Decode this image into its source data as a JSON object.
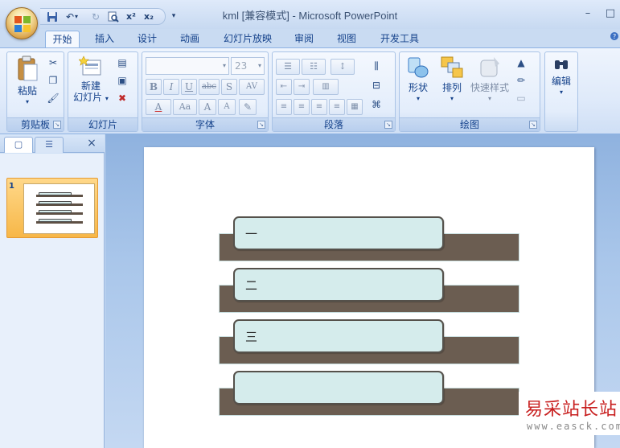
{
  "window": {
    "title": "kml [兼容模式] - Microsoft PowerPoint",
    "minimize_icon": "–",
    "maximize_icon": "□"
  },
  "qat": {
    "save_icon": "floppy",
    "undo_icon": "↶",
    "undo_arrow": "▾",
    "redo_icon": "↻",
    "preview_icon": "magnifier",
    "superscript": "x²",
    "subscript": "x₂",
    "customize": "▾"
  },
  "tabs": [
    {
      "label": "开始",
      "active": true
    },
    {
      "label": "插入"
    },
    {
      "label": "设计"
    },
    {
      "label": "动画"
    },
    {
      "label": "幻灯片放映"
    },
    {
      "label": "审阅"
    },
    {
      "label": "视图"
    },
    {
      "label": "开发工具"
    }
  ],
  "ribbon": {
    "clipboard": {
      "paste": "粘贴",
      "group": "剪贴板"
    },
    "slides": {
      "new_slide_line1": "新建",
      "new_slide_line2": "幻灯片",
      "group": "幻灯片"
    },
    "font": {
      "font_name": "",
      "font_size": "23",
      "group": "字体",
      "bold": "B",
      "italic": "I",
      "underline": "U",
      "strike": "abc",
      "shadow": "S",
      "spacing": "AV",
      "color": "A",
      "case": "Aa",
      "grow": "A",
      "shrink": "A"
    },
    "paragraph": {
      "group": "段落"
    },
    "drawing": {
      "shapes": "形状",
      "arrange": "排列",
      "quick_styles": "快速样式",
      "group": "绘图"
    },
    "editing": {
      "label": "编辑"
    }
  },
  "leftpane": {
    "close": "×",
    "slide_number": "1"
  },
  "slide": {
    "boxes": [
      {
        "text": "一"
      },
      {
        "text": "二"
      },
      {
        "text": "三"
      },
      {
        "text": ""
      }
    ]
  },
  "watermark": {
    "title": "易采站长站",
    "url": "www.easck.com"
  }
}
